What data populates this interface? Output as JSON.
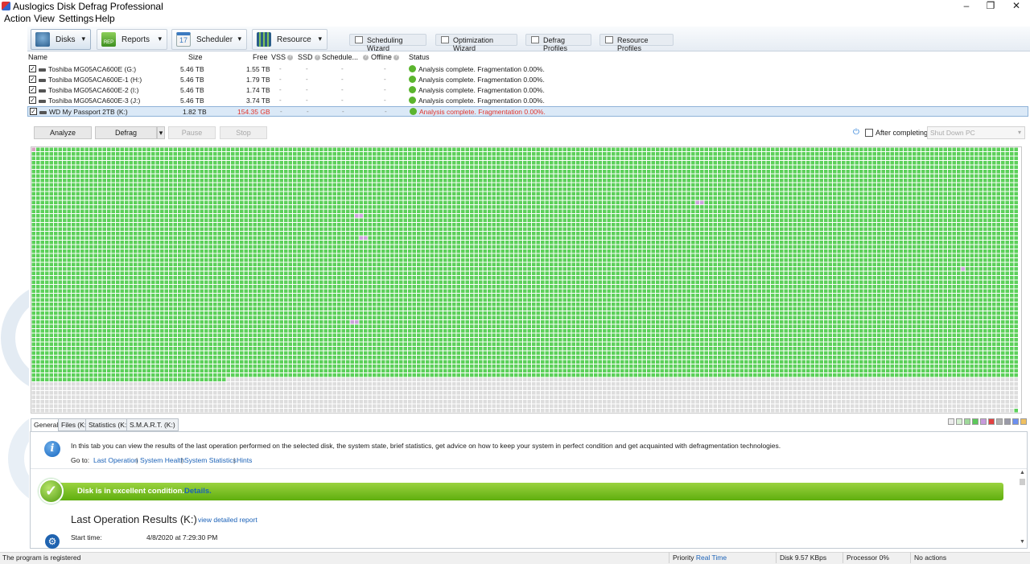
{
  "window": {
    "title": "Auslogics Disk Defrag Professional",
    "controls": {
      "minimize": "–",
      "maximize": "❐",
      "close": "✕"
    }
  },
  "menu": [
    "Action",
    "View",
    "Settings",
    "Help"
  ],
  "toolbar": {
    "disks": "Disks",
    "reports": "Reports",
    "scheduler": "Scheduler",
    "scheduler_day": "17",
    "resource": "Resource",
    "reports_badge": "REP",
    "wizards": [
      "Scheduling Wizard",
      "Optimization Wizard",
      "Defrag Profiles",
      "Resource Profiles"
    ]
  },
  "disk_table": {
    "columns": [
      "Name",
      "Size",
      "Free",
      "VSS",
      "SSD",
      "Schedule...",
      "Offline",
      "Status"
    ],
    "rows": [
      {
        "name": "Toshiba MG05ACA600E (G:)",
        "size": "5.46 TB",
        "free": "1.55 TB",
        "vss": "-",
        "ssd": "-",
        "schedule": "-",
        "offline": "-",
        "status": "Analysis complete. Fragmentation 0.00%.",
        "checked": "✓"
      },
      {
        "name": "Toshiba MG05ACA600E-1 (H:)",
        "size": "5.46 TB",
        "free": "1.79 TB",
        "vss": "-",
        "ssd": "-",
        "schedule": "-",
        "offline": "-",
        "status": "Analysis complete. Fragmentation 0.00%.",
        "checked": "✓"
      },
      {
        "name": "Toshiba MG05ACA600E-2 (I:)",
        "size": "5.46 TB",
        "free": "1.74 TB",
        "vss": "-",
        "ssd": "-",
        "schedule": "-",
        "offline": "-",
        "status": "Analysis complete. Fragmentation 0.00%.",
        "checked": "✓"
      },
      {
        "name": "Toshiba MG05ACA600E-3 (J:)",
        "size": "5.46 TB",
        "free": "3.74 TB",
        "vss": "-",
        "ssd": "-",
        "schedule": "-",
        "offline": "-",
        "status": "Analysis complete. Fragmentation 0.00%.",
        "checked": "✓"
      },
      {
        "name": "WD My Passport 2TB (K:)",
        "size": "1.82 TB",
        "free": "154.35 GB",
        "vss": "-",
        "ssd": "-",
        "schedule": "-",
        "offline": "-",
        "status": "Analysis complete. Fragmentation 0.00%.",
        "checked": "✓"
      }
    ],
    "selected_row": 4,
    "hint_glyph": "?"
  },
  "actions": {
    "analyze": "Analyze",
    "defrag": "Defrag",
    "caret": "▾",
    "pause": "Pause",
    "stop": "Stop",
    "after_completing_label": "After completing:",
    "after_completing_value": "Shut Down PC",
    "power_glyph": "⏻"
  },
  "cluster_map": {
    "used_fraction": 0.87,
    "colors": {
      "used": "#5cd05a",
      "free": "#dddddd",
      "grid": "#ffffff",
      "fragmented": "#c9a2d9",
      "mft": "#d5a0c0"
    }
  },
  "bottom_tabs": [
    "General",
    "Files (K:)",
    "Statistics (K:)",
    "S.M.A.R.T. (K:)"
  ],
  "legend_colors": [
    "#ececec",
    "#d7efd3",
    "#9fd99a",
    "#5cc95a",
    "#c79bdc",
    "#e24040",
    "#b0b0b0",
    "#9a9aa8",
    "#6b8ff0",
    "#f0c060"
  ],
  "general": {
    "info_icon": "i",
    "info_text": "In this tab you can view the results of the last operation performed on the selected disk, the system state, brief statistics, get advice on how to keep your system in perfect condition and get acquainted with defragmentation technologies.",
    "goto_label": "Go to:",
    "goto_links": [
      "Last Operation",
      "System Health",
      "System Statistics",
      "Hints"
    ],
    "goto_sep": "|",
    "health_check": "✓",
    "health_text": "Disk is in excellent condition.",
    "health_link": "Details.",
    "results_title": "Last Operation Results (K:)",
    "report_link": "view detailed report",
    "start_time_label": "Start time:",
    "start_time_value": "4/8/2020 at 7:29:30 PM",
    "gear_glyph": "⚙",
    "scroll_up": "▲",
    "scroll_down": "▼"
  },
  "statusbar": {
    "registered": "The program is registered",
    "priority_label": "Priority",
    "priority_value": "Real Time",
    "disk": "Disk 9.57 KBps",
    "processor": "Processor 0%",
    "actions": "No actions"
  }
}
